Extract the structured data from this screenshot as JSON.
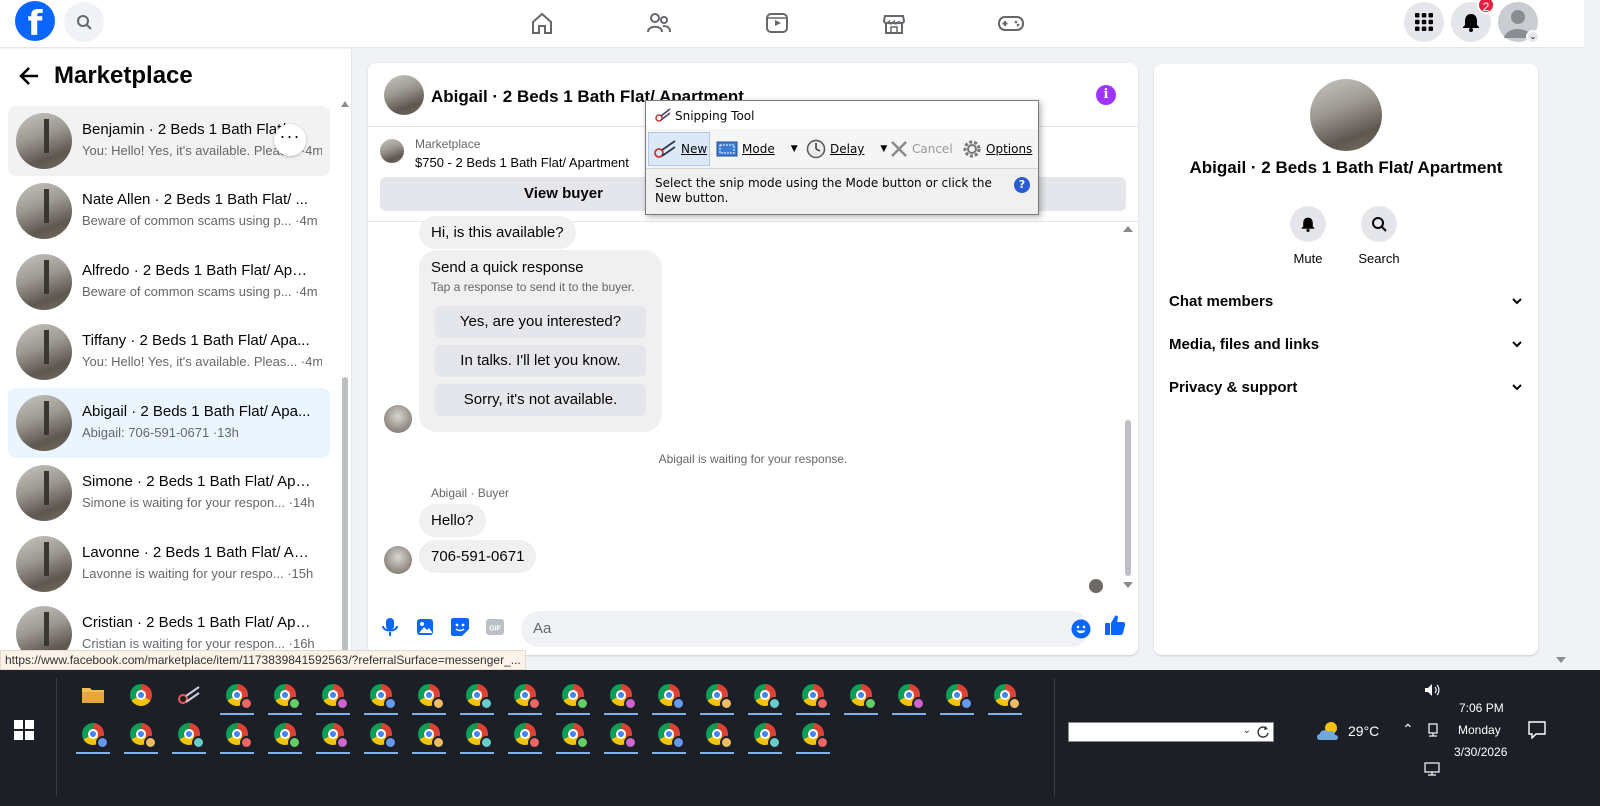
{
  "topnav": {
    "notification_count": "2"
  },
  "left": {
    "title": "Marketplace",
    "conversations": [
      {
        "name": "Benjamin · 2 Beds 1 Bath Flat/ ...",
        "sub": "You: Hello! Yes, it's available. Pleas... ·4m"
      },
      {
        "name": "Nate Allen · 2 Beds 1 Bath Flat/ ...",
        "sub": "Beware of common scams using p... ·4m"
      },
      {
        "name": "Alfredo · 2 Beds 1 Bath Flat/ Apa...",
        "sub": "Beware of common scams using p... ·4m"
      },
      {
        "name": "Tiffany · 2 Beds 1 Bath Flat/ Apa...",
        "sub": "You: Hello! Yes, it's available. Pleas... ·4m"
      },
      {
        "name": "Abigail · 2 Beds 1 Bath Flat/ Apa...",
        "sub": "Abigail: 706-591-0671 ·13h"
      },
      {
        "name": "Simone · 2 Beds 1 Bath Flat/ Apa...",
        "sub": "Simone is waiting for your respon... ·14h"
      },
      {
        "name": "Lavonne · 2 Beds 1 Bath Flat/ Ap...",
        "sub": "Lavonne is waiting for your respo... ·15h"
      },
      {
        "name": "Cristian · 2 Beds 1 Bath Flat/ Apa...",
        "sub": "Cristian is waiting for your respon... ·16h"
      }
    ],
    "more_label": "···"
  },
  "chat": {
    "title": "Abigail · 2 Beds 1 Bath Flat/ Apartment",
    "listing_label": "Marketplace",
    "listing_price": "$750 - 2 Beds 1 Bath Flat/ Apartment",
    "view_buyer": "View buyer",
    "first_message": "Hi, is this available?",
    "quick_title": "Send a quick response",
    "quick_sub": "Tap a response to send it to the buyer.",
    "quick_responses": [
      "Yes, are you interested?",
      "In talks. I'll let you know.",
      "Sorry, it's not available."
    ],
    "waiting_text": "Abigail is waiting for your response.",
    "sender_label": "Abigail · Buyer",
    "msg_hello": "Hello?",
    "msg_phone": "706-591-0671",
    "composer_placeholder": "Aa"
  },
  "right": {
    "name": "Abigail · 2 Beds 1 Bath Flat/ Apartment",
    "mute": "Mute",
    "search": "Search",
    "sections": [
      "Chat members",
      "Media, files and links",
      "Privacy & support"
    ]
  },
  "status_url": "https://www.facebook.com/marketplace/item/1173839841592563/?referralSurface=messenger_...",
  "snipping_tool": {
    "title": "Snipping Tool",
    "new": "New",
    "mode": "Mode",
    "delay": "Delay",
    "cancel": "Cancel",
    "options": "Options",
    "message": "Select the snip mode using the Mode button or click the New button.",
    "help": "?"
  },
  "taskbar": {
    "temperature": "29°C",
    "time": "7:06 PM",
    "day": "Monday",
    "date": "3/30/2026"
  },
  "colors": {
    "facebook_blue": "#0866ff",
    "active_conversation": "#ebf5ff",
    "info_purple": "#a033ff",
    "like_blue": "#0866ff",
    "notification_red": "#e41e3f"
  }
}
